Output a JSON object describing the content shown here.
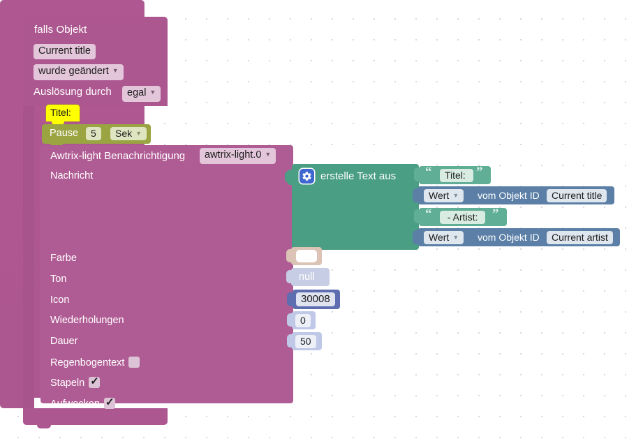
{
  "workspace": {
    "background": "#ffffff",
    "grid_dot_color": "#d8d8de"
  },
  "hat_block": {
    "name": "falls-objekt",
    "title": "falls Objekt",
    "color": "#ad5790",
    "object_id": "Current title",
    "trigger": "wurde geändert",
    "trigger_by_label": "Auslösung durch",
    "trigger_by_value": "egal"
  },
  "comment_note": {
    "text": "Titel:",
    "color": "#ffff00"
  },
  "pause_block": {
    "label": "Pause",
    "value": "5",
    "unit": "Sek",
    "color": "#9aa441"
  },
  "awtrix_block": {
    "title": "Awtrix-light Benachrichtigung",
    "instance": "awtrix-light.0",
    "color": "#b05c94",
    "rows": [
      {
        "label": "Nachricht"
      },
      {
        "label": "Farbe"
      },
      {
        "label": "Ton"
      },
      {
        "label": "Icon"
      },
      {
        "label": "Wiederholungen"
      },
      {
        "label": "Dauer"
      },
      {
        "label": "Regenbogentext",
        "checkbox": false
      },
      {
        "label": "Stapeln",
        "checkbox": true
      },
      {
        "label": "Aufwecken",
        "checkbox": true
      }
    ]
  },
  "text_join_block": {
    "title": "erstelle Text aus",
    "color": "#4a9e83",
    "gear_icon": "gear-icon",
    "items": [
      {
        "type": "string",
        "value": "Titel: "
      },
      {
        "type": "object_value",
        "selector": "Wert",
        "mid_label": "vom Objekt ID",
        "object_id": "Current title"
      },
      {
        "type": "string",
        "value": " - Artist: "
      },
      {
        "type": "object_value",
        "selector": "Wert",
        "mid_label": "vom Objekt ID",
        "object_id": "Current artist"
      }
    ]
  },
  "value_blocks": {
    "farbe": {
      "type": "colour",
      "swatch": "#ffffff",
      "block_color": "#dbc3b5"
    },
    "ton": {
      "type": "null",
      "value": "null",
      "block_color": "#c7cde4"
    },
    "icon": {
      "type": "text",
      "value": "30008",
      "block_color": "#5d6daf"
    },
    "wiederholungen": {
      "type": "number",
      "value": "0",
      "block_color": "#c0c8e8"
    },
    "dauer": {
      "type": "number",
      "value": "50",
      "block_color": "#c0c8e8"
    }
  }
}
